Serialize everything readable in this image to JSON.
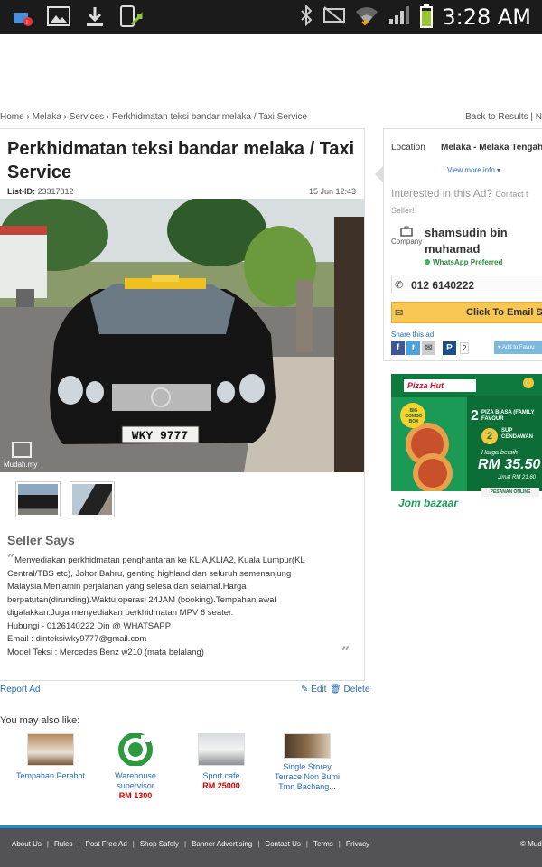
{
  "status_bar": {
    "time": "3:28 AM",
    "icons_left": [
      "google-plus-notification-icon",
      "gallery-icon",
      "download-icon",
      "screenshot-icon"
    ],
    "icons_right": [
      "bluetooth-icon",
      "mute-icon",
      "wifi-icon",
      "signal-icon",
      "battery-icon"
    ]
  },
  "breadcrumb": {
    "items": [
      "Home",
      "Melaka",
      "Services",
      "Perkhidmatan teksi bandar melaka / Taxi Service"
    ],
    "back": "Back to Results",
    "next": "N"
  },
  "listing": {
    "title": "Perkhidmatan teksi bandar melaka / Taxi Service",
    "list_id_label": "List-ID:",
    "list_id": "23317812",
    "date": "15 Jun 12:43",
    "photo_watermark": "Mudah.my",
    "plate": "WKY 9777",
    "seller_says": "Seller Says",
    "description": [
      "Menyediakan perkhidmatan penghantaran ke KLIA,KLIA2, Kuala Lumpur(KL Central/TBS etc), Johor Bahru, genting highland dan seluruh semenanjung Malaysia.Menjamin perjalanan yang selesa dan selamat.Harga berpatutan(dirunding).Waktu operasi 24JAM (booking).Tempahan awal digalakkan.Juga menyediakan perkhidmatan MPV 6 seater.",
      "Hubungi - 0126140222 Din @ WHATSAPP",
      "Email : dinteksiwky9777@gmail.com",
      "Model Teksi : Mercedes Benz w210 (mata belalang)"
    ],
    "report": "Report Ad",
    "edit": "Edit",
    "delete": "Delete"
  },
  "also_like": {
    "heading": "You may also like:",
    "items": [
      {
        "title": "Tempahan Perabot",
        "price": ""
      },
      {
        "title": "Warehouse supervisor",
        "price": "RM 1300"
      },
      {
        "title": "Sport cafe",
        "price": "RM 25000"
      },
      {
        "title": "Single Storey Terrace Non Bumi Tmn Bachang...",
        "price": ""
      }
    ]
  },
  "sidebar": {
    "location_label": "Location",
    "location_value": "Melaka - Melaka Tengah",
    "view_more": "View more info",
    "interested": "Interested in this Ad?",
    "contact": "Contact t",
    "seller_suffix": "Seller!",
    "company_label": "Company",
    "seller_name": "shamsudin bin muhamad",
    "whatsapp": "WhatsApp Preferred",
    "phone": "012 6140222",
    "email_btn": "Click To Email Se",
    "share_label": "Share this ad",
    "share_count": "2",
    "fav_btn": "Add to Favou"
  },
  "ad_banner": {
    "brand": "Pizza Hut",
    "line1_num": "2",
    "line1": "PIZA BIASA (FAMILY FAVOUR",
    "line2_num": "2",
    "line2": "SUP CENDAWAN",
    "price_label": "Harga bersih",
    "price": "RM 35.50",
    "save": "Jimat RM 21.60",
    "cta": "PESANAN ONLINE",
    "sticker": "BIG COMBO BOX",
    "logo": "Jom bazaar"
  },
  "footer": {
    "links": [
      "About Us",
      "Rules",
      "Post Free Ad",
      "Shop Safely",
      "Banner Advertising",
      "Contact Us",
      "Terms",
      "Privacy"
    ],
    "copyright": "© Mud"
  },
  "colors": {
    "link": "#2a6ab0",
    "price": "#cc0000",
    "email_button": "#f8c653",
    "footer_bg": "#525257",
    "footer_border": "#1f8fd0",
    "statusbar_bg": "#1b1b1b",
    "ad_bg": "#1a9a54"
  }
}
